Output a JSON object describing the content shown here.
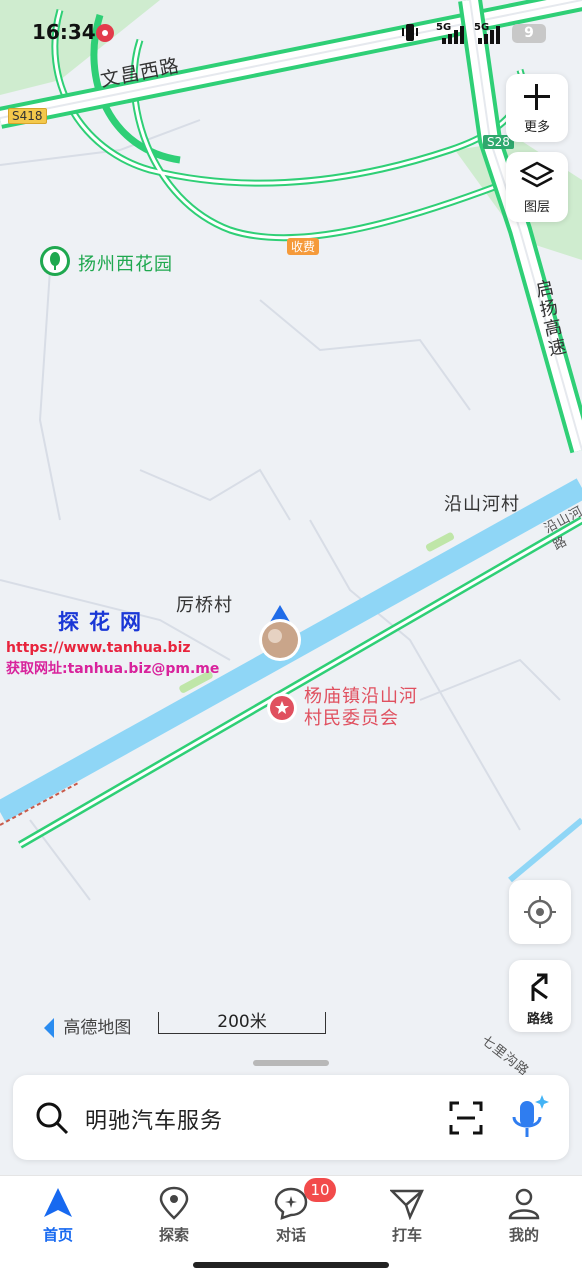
{
  "status_bar": {
    "time": "16:34",
    "net1": "5G",
    "net2": "5G",
    "battery": "9"
  },
  "map": {
    "roads": [
      "文昌西路",
      "启扬高速"
    ],
    "road_badges": [
      "S418",
      "S28"
    ],
    "toll_badge": "收费",
    "park_label": "扬州西花园",
    "villages": [
      "沿山河村",
      "厉桥村"
    ],
    "road_edge_label": "沿山河路",
    "road_bottom_label": "七里沟路",
    "poi": "杨庙镇沿山河村民委员会",
    "poi_line1": "杨庙镇沿山河",
    "poi_line2": "村民委员会",
    "brand": "高德地图",
    "scale": "200米"
  },
  "side_buttons": {
    "more": "更多",
    "layers": "图层",
    "route": "路线"
  },
  "watermark": {
    "title": "探花网",
    "url": "https://www.tanhua.biz",
    "contact": "获取网址:tanhua.biz@pm.me"
  },
  "search": {
    "value": "明驰汽车服务"
  },
  "tabs": [
    {
      "label": "首页",
      "icon": "navigation-arrow-icon",
      "active": true
    },
    {
      "label": "探索",
      "icon": "location-pin-icon",
      "active": false
    },
    {
      "label": "对话",
      "icon": "chat-bubble-icon",
      "active": false
    },
    {
      "label": "打车",
      "icon": "taxi-icon",
      "active": false
    },
    {
      "label": "我的",
      "icon": "profile-icon",
      "active": false
    }
  ],
  "chat_badge": "10",
  "colors": {
    "accent": "#1769f0",
    "highway": "#2fcf76",
    "river": "#8fd6f6",
    "poi": "#e0505f",
    "park": "#1fa84f"
  }
}
